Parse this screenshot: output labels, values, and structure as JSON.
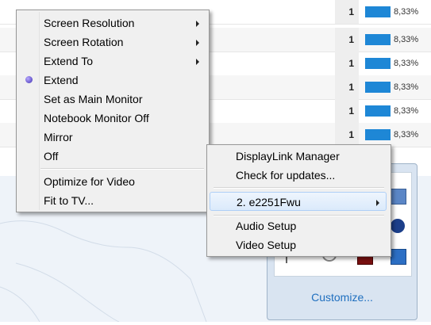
{
  "table": {
    "rows": [
      {
        "count": "1",
        "percent": "8,33%"
      },
      {
        "count": "1",
        "percent": "8,33%"
      },
      {
        "count": "1",
        "percent": "8,33%"
      },
      {
        "count": "1",
        "percent": "8,33%"
      },
      {
        "count": "1",
        "percent": "8,33%"
      },
      {
        "count": "1",
        "percent": "8,33%"
      }
    ],
    "bar_fraction": 0.0833,
    "bar_color": "#1e87d6"
  },
  "context_menu": {
    "items": [
      {
        "label": "Screen Resolution",
        "submenu": true
      },
      {
        "label": "Screen Rotation",
        "submenu": true
      },
      {
        "label": "Extend To",
        "submenu": true
      },
      {
        "label": "Extend",
        "selected": true
      },
      {
        "label": "Set as Main Monitor"
      },
      {
        "label": "Notebook Monitor Off"
      },
      {
        "label": "Mirror"
      },
      {
        "label": "Off"
      },
      {
        "label": "Optimize for Video"
      },
      {
        "label": "Fit to TV..."
      }
    ]
  },
  "displaylink_menu": {
    "items": [
      {
        "label": "DisplayLink Manager"
      },
      {
        "label": "Check for updates..."
      },
      {
        "label": "2. e2251Fwu",
        "submenu": true,
        "highlighted": true
      },
      {
        "label": "Audio Setup"
      },
      {
        "label": "Video Setup"
      }
    ]
  },
  "tray": {
    "customize_label": "Customize...",
    "icons": [
      "monitor-icon",
      "bluetooth-icon",
      "flag-icon",
      "network-icon",
      "app-icon",
      "usb-icon"
    ]
  },
  "colors": {
    "accent": "#1e87d6",
    "link": "#1f6fbf",
    "menu_bg": "#f0f0f0"
  }
}
